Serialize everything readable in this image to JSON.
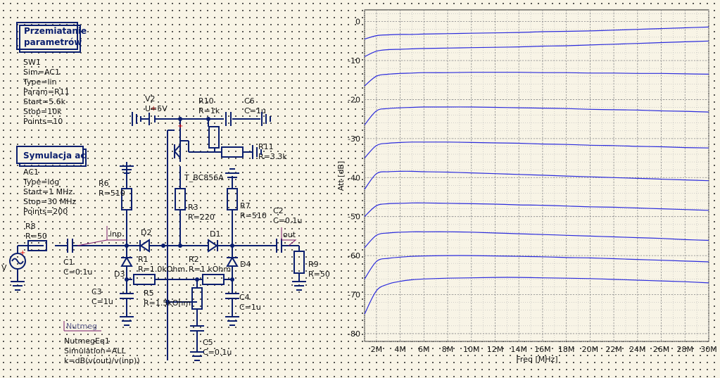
{
  "sweep": {
    "header": "Przemiatanie parametrów",
    "header_lines": [
      "Przemiatanie",
      "parametrów"
    ],
    "name": "SW1",
    "lines": [
      "Sim=AC1",
      "Type=lin",
      "Param=R11",
      "Start=5.6k",
      "Stop=10k",
      "Points=10"
    ]
  },
  "ac_sim": {
    "header": "Symulacja ac",
    "name": "AC1",
    "lines": [
      "Type=log",
      "Start=1 MHz",
      "Stop=30 MHz",
      "Points=200"
    ]
  },
  "nutmeg": {
    "header": "Nutmeg",
    "name": "NutmegEq1",
    "lines": [
      "Simulation=ALL",
      "k=dB(v(out)/v(inp))"
    ]
  },
  "components": [
    {
      "id": "V2",
      "value": "U=5V"
    },
    {
      "id": "R10",
      "value": "R=1k"
    },
    {
      "id": "C6",
      "value": "C=1u"
    },
    {
      "id": "R11",
      "value": "R=3.3k"
    },
    {
      "id": "T_BC856A",
      "value": ""
    },
    {
      "id": "R6",
      "value": "R=510"
    },
    {
      "id": "R3",
      "value": "R=220"
    },
    {
      "id": "R7",
      "value": "R=510"
    },
    {
      "id": "C2",
      "value": "C=0.1u"
    },
    {
      "id": "R8",
      "value": "R=50"
    },
    {
      "id": "C1",
      "value": "C=0.1u"
    },
    {
      "id": "D2",
      "value": ""
    },
    {
      "id": "D1",
      "value": ""
    },
    {
      "id": "R9",
      "value": "R=50"
    },
    {
      "id": "R1",
      "value": "R=1.0kOhm"
    },
    {
      "id": "R2",
      "value": "R=1 kOhm"
    },
    {
      "id": "D3",
      "value": ""
    },
    {
      "id": "D4",
      "value": ""
    },
    {
      "id": "R5",
      "value": "R=1.5kOhm"
    },
    {
      "id": "C3",
      "value": "C=1u"
    },
    {
      "id": "C4",
      "value": "C=1u"
    },
    {
      "id": "C5",
      "value": "C=0.1u"
    }
  ],
  "node_labels": [
    "inp",
    "out"
  ],
  "source_label": "V",
  "chart_data": {
    "type": "line",
    "xlabel": "Freq [MHz]",
    "ylabel": "Att [dB]",
    "xlim": [
      1,
      30
    ],
    "ylim": [
      -82,
      3
    ],
    "x_ticks": [
      2,
      4,
      6,
      8,
      10,
      12,
      14,
      16,
      18,
      20,
      22,
      24,
      26,
      28,
      30
    ],
    "x_tick_labels": [
      "2M",
      "4M",
      "6M",
      "8M",
      "10M",
      "12M",
      "14M",
      "16M",
      "18M",
      "20M",
      "22M",
      "24M",
      "26M",
      "28M",
      "30M"
    ],
    "y_ticks": [
      0,
      -10,
      -20,
      -30,
      -40,
      -50,
      -60,
      -70,
      -80
    ],
    "y_tick_labels": [
      "0",
      "-10",
      "-20",
      "-30",
      "-40",
      "-50",
      "-60",
      "-70",
      "-80"
    ],
    "grid": true,
    "line_color": "#2b2bdc",
    "x": [
      1,
      2,
      3,
      4,
      5,
      6,
      8,
      10,
      12,
      14,
      16,
      18,
      20,
      22,
      24,
      26,
      28,
      30
    ],
    "series": [
      {
        "values": [
          -4.5,
          -3.6,
          -3.4,
          -3.3,
          -3.3,
          -3.2,
          -3.1,
          -3.0,
          -2.9,
          -2.8,
          -2.6,
          -2.5,
          -2.4,
          -2.2,
          -2.0,
          -1.8,
          -1.6,
          -1.4
        ]
      },
      {
        "values": [
          -9.0,
          -7.6,
          -7.2,
          -7.1,
          -7.0,
          -6.9,
          -6.8,
          -6.7,
          -6.6,
          -6.5,
          -6.3,
          -6.2,
          -6.0,
          -5.8,
          -5.6,
          -5.4,
          -5.2,
          -5.0
        ]
      },
      {
        "values": [
          -16.5,
          -14.0,
          -13.5,
          -13.3,
          -13.2,
          -13.1,
          -13.1,
          -13.0,
          -13.0,
          -13.0,
          -13.1,
          -13.1,
          -13.2,
          -13.2,
          -13.3,
          -13.3,
          -13.4,
          -13.5
        ]
      },
      {
        "values": [
          -26.5,
          -22.9,
          -22.3,
          -22.1,
          -22.0,
          -21.9,
          -21.9,
          -21.9,
          -22.0,
          -22.1,
          -22.2,
          -22.3,
          -22.5,
          -22.6,
          -22.7,
          -22.9,
          -23.0,
          -23.2
        ]
      },
      {
        "values": [
          -35.0,
          -31.8,
          -31.2,
          -31.0,
          -30.9,
          -30.9,
          -30.9,
          -31.0,
          -31.1,
          -31.2,
          -31.4,
          -31.5,
          -31.7,
          -31.8,
          -32.0,
          -32.1,
          -32.3,
          -32.4
        ]
      },
      {
        "values": [
          -43.0,
          -39.0,
          -38.5,
          -38.4,
          -38.4,
          -38.5,
          -38.6,
          -38.8,
          -39.0,
          -39.2,
          -39.4,
          -39.6,
          -39.8,
          -40.0,
          -40.2,
          -40.4,
          -40.6,
          -40.8
        ]
      },
      {
        "values": [
          -50.0,
          -47.2,
          -46.7,
          -46.6,
          -46.5,
          -46.5,
          -46.6,
          -46.7,
          -46.8,
          -47.0,
          -47.1,
          -47.3,
          -47.5,
          -47.6,
          -47.8,
          -48.0,
          -48.2,
          -48.4
        ]
      },
      {
        "values": [
          -58.0,
          -54.8,
          -54.2,
          -54.0,
          -53.9,
          -53.9,
          -53.9,
          -54.0,
          -54.2,
          -54.4,
          -54.6,
          -54.8,
          -55.0,
          -55.2,
          -55.4,
          -55.6,
          -55.9,
          -56.1
        ]
      },
      {
        "values": [
          -66.0,
          -61.5,
          -60.7,
          -60.4,
          -60.2,
          -60.1,
          -60.0,
          -60.0,
          -60.1,
          -60.2,
          -60.3,
          -60.5,
          -60.6,
          -60.8,
          -61.0,
          -61.2,
          -61.4,
          -61.6
        ]
      },
      {
        "values": [
          -75.0,
          -69.0,
          -67.3,
          -66.6,
          -66.2,
          -66.0,
          -65.8,
          -65.7,
          -65.6,
          -65.6,
          -65.7,
          -65.8,
          -65.9,
          -66.1,
          -66.3,
          -66.5,
          -66.7,
          -67.0
        ]
      }
    ]
  }
}
